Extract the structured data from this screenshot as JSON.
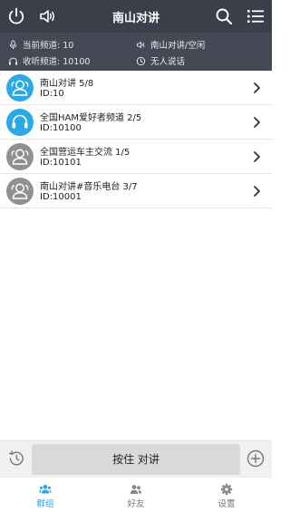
{
  "header": {
    "title": "南山对讲"
  },
  "status": {
    "current_channel": "当前频道: 10",
    "listening_channel": "收听频道: 10100",
    "channel_state": "南山对讲/空闲",
    "speaker_state": "无人说话"
  },
  "channels": [
    {
      "name": "南山对讲 5/8",
      "id": "ID:10",
      "avatar_color": "#2aa9e6"
    },
    {
      "name": "全国HAM爱好者频道 2/5",
      "id": "ID:10100",
      "avatar_color": "#2aa9e6"
    },
    {
      "name": "全国营运车主交流 1/5",
      "id": "ID:10101",
      "avatar_color": "#8f9090"
    },
    {
      "name": "南山对讲#音乐电台 3/7",
      "id": "ID:10001",
      "avatar_color": "#8f9090"
    }
  ],
  "talk": {
    "button_label": "按住 对讲"
  },
  "tabs": [
    {
      "label": "群组",
      "icon": "group-icon",
      "active": true
    },
    {
      "label": "好友",
      "icon": "friends-icon",
      "active": false
    },
    {
      "label": "设置",
      "icon": "settings-icon",
      "active": false
    }
  ],
  "colors": {
    "header_bg": "#3c3f4a",
    "status_bg": "#454955",
    "accent": "#2aa9e6",
    "inactive_avatar": "#8f9090"
  }
}
